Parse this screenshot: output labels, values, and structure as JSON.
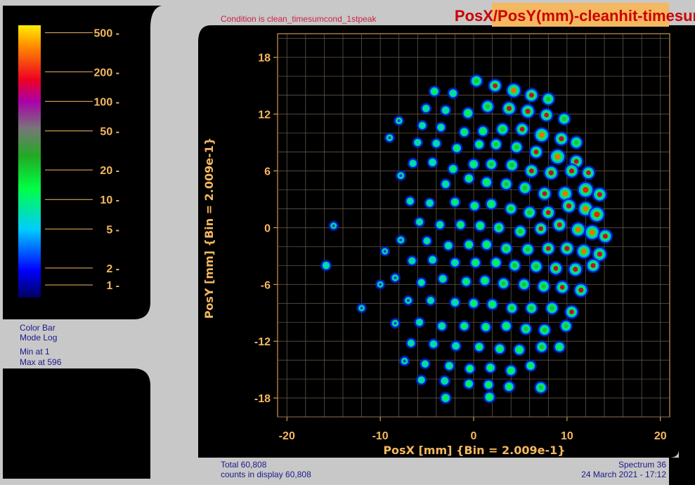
{
  "title": "PosX/PosY(mm)-cleanhit-timesum",
  "condition": "Condition is clean_timesumcond_1stpeak",
  "colorbar": {
    "ticks": [
      "500",
      "200",
      "100",
      "50",
      "20",
      "10",
      "5",
      "2",
      "1"
    ],
    "tick_values": [
      500,
      200,
      100,
      50,
      20,
      10,
      5,
      2,
      1
    ],
    "mode_label": "Color Bar",
    "mode_value": "Mode Log",
    "min_label": "Min at 1",
    "max_label": "Max at 596"
  },
  "footer": {
    "total": "Total 60,808",
    "counts": "counts in display 60,808",
    "spectrum": "Spectrum 36",
    "date": "24 March 2021 - 17:12"
  },
  "colors": {
    "frame": "#c8c8c8",
    "plot_bg": "#000000",
    "grid": "#7a6a55",
    "tick_text": "#f4b860",
    "title_bg": "#f4b860",
    "title_text": "#cc0000"
  },
  "chart_data": {
    "type": "heatmap",
    "xlabel": "PosX [mm] {Bin = 2.009e-1}",
    "ylabel": "PosY [mm] {Bin = 2.009e-1}",
    "xlim": [
      -21,
      21
    ],
    "ylim": [
      -20,
      20.5
    ],
    "xticks": [
      "-20",
      "-10",
      "0",
      "10",
      "20"
    ],
    "xtick_values": [
      -20,
      -10,
      0,
      10,
      20
    ],
    "yticks": [
      "18",
      "12",
      "6",
      "0",
      "-6",
      "-12",
      "-18"
    ],
    "ytick_values": [
      18,
      12,
      6,
      0,
      -6,
      -12,
      -18
    ],
    "grid": true,
    "scale": "log",
    "spots": [
      [
        -4.2,
        14.4,
        8
      ],
      [
        -2.2,
        14.2,
        6
      ],
      [
        0.3,
        15.5,
        30
      ],
      [
        2.3,
        15.0,
        60
      ],
      [
        4.3,
        14.5,
        150
      ],
      [
        6.2,
        14.0,
        80
      ],
      [
        8.0,
        13.6,
        40
      ],
      [
        -5.1,
        12.6,
        5
      ],
      [
        -3.0,
        12.4,
        6
      ],
      [
        -0.6,
        12.1,
        15
      ],
      [
        1.5,
        12.8,
        40
      ],
      [
        3.8,
        12.6,
        90
      ],
      [
        5.8,
        12.3,
        110
      ],
      [
        7.8,
        11.9,
        60
      ],
      [
        9.7,
        11.5,
        30
      ],
      [
        -8.0,
        11.3,
        3
      ],
      [
        -5.5,
        10.8,
        4
      ],
      [
        -3.5,
        10.6,
        5
      ],
      [
        -1.0,
        10.1,
        8
      ],
      [
        1.0,
        10.2,
        12
      ],
      [
        3.1,
        10.4,
        35
      ],
      [
        5.2,
        10.4,
        60
      ],
      [
        7.3,
        9.8,
        200
      ],
      [
        9.4,
        9.4,
        90
      ],
      [
        11.0,
        9.0,
        40
      ],
      [
        -9.0,
        9.5,
        3
      ],
      [
        -6.0,
        9.0,
        4
      ],
      [
        -4.0,
        8.9,
        5
      ],
      [
        -1.8,
        8.4,
        8
      ],
      [
        0.6,
        8.8,
        10
      ],
      [
        2.4,
        8.8,
        20
      ],
      [
        4.6,
        8.5,
        30
      ],
      [
        6.7,
        8.0,
        60
      ],
      [
        9.0,
        7.5,
        300
      ],
      [
        11.0,
        7.0,
        70
      ],
      [
        -6.5,
        6.8,
        4
      ],
      [
        -4.4,
        6.9,
        6
      ],
      [
        -2.2,
        6.2,
        8
      ],
      [
        0.0,
        6.7,
        12
      ],
      [
        1.9,
        6.7,
        20
      ],
      [
        4.1,
        6.6,
        40
      ],
      [
        6.2,
        6.0,
        70
      ],
      [
        8.3,
        5.8,
        120
      ],
      [
        10.5,
        6.0,
        90
      ],
      [
        12.3,
        5.8,
        60
      ],
      [
        -7.8,
        5.5,
        3
      ],
      [
        -3.0,
        4.6,
        6
      ],
      [
        -0.5,
        5.2,
        9
      ],
      [
        1.4,
        4.8,
        15
      ],
      [
        3.5,
        4.6,
        25
      ],
      [
        5.5,
        4.2,
        45
      ],
      [
        7.6,
        3.6,
        70
      ],
      [
        9.8,
        3.6,
        150
      ],
      [
        12.0,
        4.0,
        400
      ],
      [
        13.5,
        3.5,
        100
      ],
      [
        -6.8,
        2.8,
        4
      ],
      [
        -4.7,
        2.6,
        5
      ],
      [
        -2.0,
        2.7,
        7
      ],
      [
        0.1,
        2.3,
        10
      ],
      [
        1.9,
        2.5,
        15
      ],
      [
        4.0,
        2.0,
        25
      ],
      [
        6.0,
        1.6,
        40
      ],
      [
        8.0,
        1.6,
        70
      ],
      [
        10.2,
        2.3,
        120
      ],
      [
        12.0,
        2.0,
        200
      ],
      [
        13.2,
        1.4,
        350
      ],
      [
        -5.8,
        0.6,
        4
      ],
      [
        -3.6,
        0.3,
        5
      ],
      [
        -1.4,
        0.3,
        8
      ],
      [
        0.7,
        0.2,
        12
      ],
      [
        2.7,
        0.0,
        20
      ],
      [
        5.0,
        -0.4,
        30
      ],
      [
        7.2,
        -0.1,
        50
      ],
      [
        9.2,
        0.3,
        80
      ],
      [
        11.2,
        -0.2,
        150
      ],
      [
        12.7,
        -0.5,
        250
      ],
      [
        14.1,
        -0.9,
        100
      ],
      [
        -7.8,
        -1.3,
        3
      ],
      [
        -5.0,
        -1.4,
        4
      ],
      [
        -2.7,
        -1.9,
        6
      ],
      [
        -0.5,
        -1.8,
        9
      ],
      [
        1.4,
        -1.8,
        14
      ],
      [
        3.5,
        -2.2,
        25
      ],
      [
        5.8,
        -2.3,
        35
      ],
      [
        8.0,
        -2.2,
        60
      ],
      [
        10.0,
        -2.2,
        100
      ],
      [
        11.8,
        -2.5,
        150
      ],
      [
        13.5,
        -2.8,
        120
      ],
      [
        -6.6,
        -3.5,
        4
      ],
      [
        -4.4,
        -3.4,
        5
      ],
      [
        -2.0,
        -3.7,
        6
      ],
      [
        0.2,
        -3.7,
        10
      ],
      [
        2.4,
        -3.7,
        15
      ],
      [
        4.4,
        -4.0,
        25
      ],
      [
        6.7,
        -4.1,
        40
      ],
      [
        8.8,
        -4.3,
        70
      ],
      [
        10.9,
        -4.4,
        100
      ],
      [
        12.8,
        -4.0,
        80
      ],
      [
        -8.4,
        -5.3,
        3
      ],
      [
        -5.6,
        -5.8,
        4
      ],
      [
        -3.3,
        -5.4,
        6
      ],
      [
        -0.8,
        -5.7,
        8
      ],
      [
        1.2,
        -5.6,
        12
      ],
      [
        3.2,
        -5.9,
        20
      ],
      [
        5.4,
        -6.0,
        25
      ],
      [
        7.5,
        -6.2,
        40
      ],
      [
        9.5,
        -6.3,
        60
      ],
      [
        11.5,
        -6.6,
        90
      ],
      [
        -7.0,
        -7.7,
        3
      ],
      [
        -4.6,
        -7.7,
        4
      ],
      [
        -2.0,
        -7.9,
        6
      ],
      [
        0.0,
        -8.0,
        9
      ],
      [
        2.0,
        -8.1,
        12
      ],
      [
        4.1,
        -8.5,
        18
      ],
      [
        6.2,
        -8.5,
        25
      ],
      [
        8.4,
        -8.5,
        40
      ],
      [
        10.5,
        -8.9,
        60
      ],
      [
        -8.4,
        -10.1,
        3
      ],
      [
        -5.8,
        -10.0,
        4
      ],
      [
        -3.4,
        -10.4,
        6
      ],
      [
        -1.0,
        -10.4,
        8
      ],
      [
        1.3,
        -10.5,
        10
      ],
      [
        3.5,
        -10.4,
        14
      ],
      [
        5.6,
        -10.7,
        20
      ],
      [
        7.6,
        -10.8,
        30
      ],
      [
        9.9,
        -10.4,
        25
      ],
      [
        -6.7,
        -12.2,
        4
      ],
      [
        -4.3,
        -12.3,
        5
      ],
      [
        -1.9,
        -12.5,
        6
      ],
      [
        0.6,
        -12.6,
        8
      ],
      [
        2.8,
        -12.8,
        12
      ],
      [
        4.9,
        -12.9,
        16
      ],
      [
        7.3,
        -12.6,
        22
      ],
      [
        9.2,
        -12.6,
        14
      ],
      [
        -7.4,
        -14.1,
        3
      ],
      [
        -5.2,
        -14.4,
        4
      ],
      [
        -2.6,
        -14.6,
        6
      ],
      [
        -0.4,
        -14.9,
        8
      ],
      [
        1.8,
        -14.8,
        10
      ],
      [
        4.0,
        -15.1,
        14
      ],
      [
        6.1,
        -14.6,
        10
      ],
      [
        -5.6,
        -16.1,
        4
      ],
      [
        -3.1,
        -16.2,
        6
      ],
      [
        -0.5,
        -16.5,
        7
      ],
      [
        1.6,
        -16.6,
        9
      ],
      [
        3.8,
        -16.8,
        12
      ],
      [
        -3.0,
        -18.0,
        10
      ],
      [
        1.7,
        -17.9,
        12
      ],
      [
        7.2,
        -16.9,
        25
      ],
      [
        -15.8,
        -4.0,
        5
      ],
      [
        -15.0,
        0.2,
        2
      ],
      [
        -10.0,
        -6.0,
        2
      ],
      [
        -9.5,
        -2.5,
        2
      ],
      [
        -12.0,
        -8.5,
        2
      ]
    ]
  }
}
